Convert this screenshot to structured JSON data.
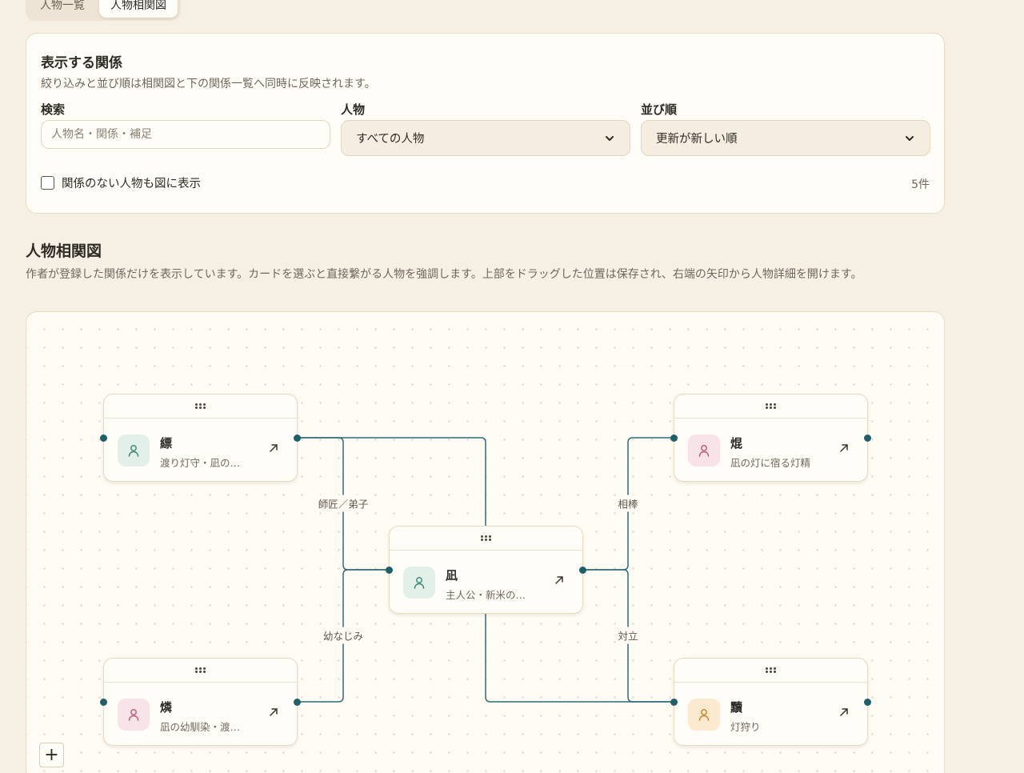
{
  "tabs": [
    {
      "label": "人物一覧",
      "active": false
    },
    {
      "label": "人物相関図",
      "active": true
    }
  ],
  "filter": {
    "title": "表示する関係",
    "description": "絞り込みと並び順は相関図と下の関係一覧へ同時に反映されます。",
    "search_label": "検索",
    "search_placeholder": "人物名・関係・補足",
    "search_value": "",
    "person_label": "人物",
    "person_value": "すべての人物",
    "sort_label": "並び順",
    "sort_value": "更新が新しい順",
    "show_isolated_label": "関係のない人物も図に表示",
    "show_isolated_checked": false,
    "count": "5件"
  },
  "diagram": {
    "title": "人物相関図",
    "description": "作者が登録した関係だけを表示しています。カードを選ぶと直接繋がる人物を強調します。上部をドラッグした位置は保存され、右端の矢印から人物詳細を開けます。",
    "zoom_in_label": "+",
    "colors": {
      "edge": "#2f6a76",
      "port": "#1f5f68"
    },
    "nodes": [
      {
        "id": "hyou",
        "name": "縹",
        "subtitle": "渡り灯守・凪の…",
        "avatar_bg": "#e3efe9",
        "avatar_fg": "#3f8a78"
      },
      {
        "id": "kon",
        "name": "焜",
        "subtitle": "凪の灯に宿る灯精",
        "avatar_bg": "#f7e3e8",
        "avatar_fg": "#c0607a"
      },
      {
        "id": "nagi",
        "name": "凪",
        "subtitle": "主人公・新米の…",
        "avatar_bg": "#e3efe9",
        "avatar_fg": "#3f8a78"
      },
      {
        "id": "rin",
        "name": "燐",
        "subtitle": "凪の幼馴染・渡…",
        "avatar_bg": "#f7e3e8",
        "avatar_fg": "#c0607a"
      },
      {
        "id": "ten",
        "name": "黷",
        "subtitle": "灯狩り",
        "avatar_bg": "#fbeacf",
        "avatar_fg": "#c98a3a"
      }
    ],
    "edges": [
      {
        "label": "師匠／弟子"
      },
      {
        "label": "相棒"
      },
      {
        "label": "幼なじみ"
      },
      {
        "label": "対立"
      }
    ]
  }
}
